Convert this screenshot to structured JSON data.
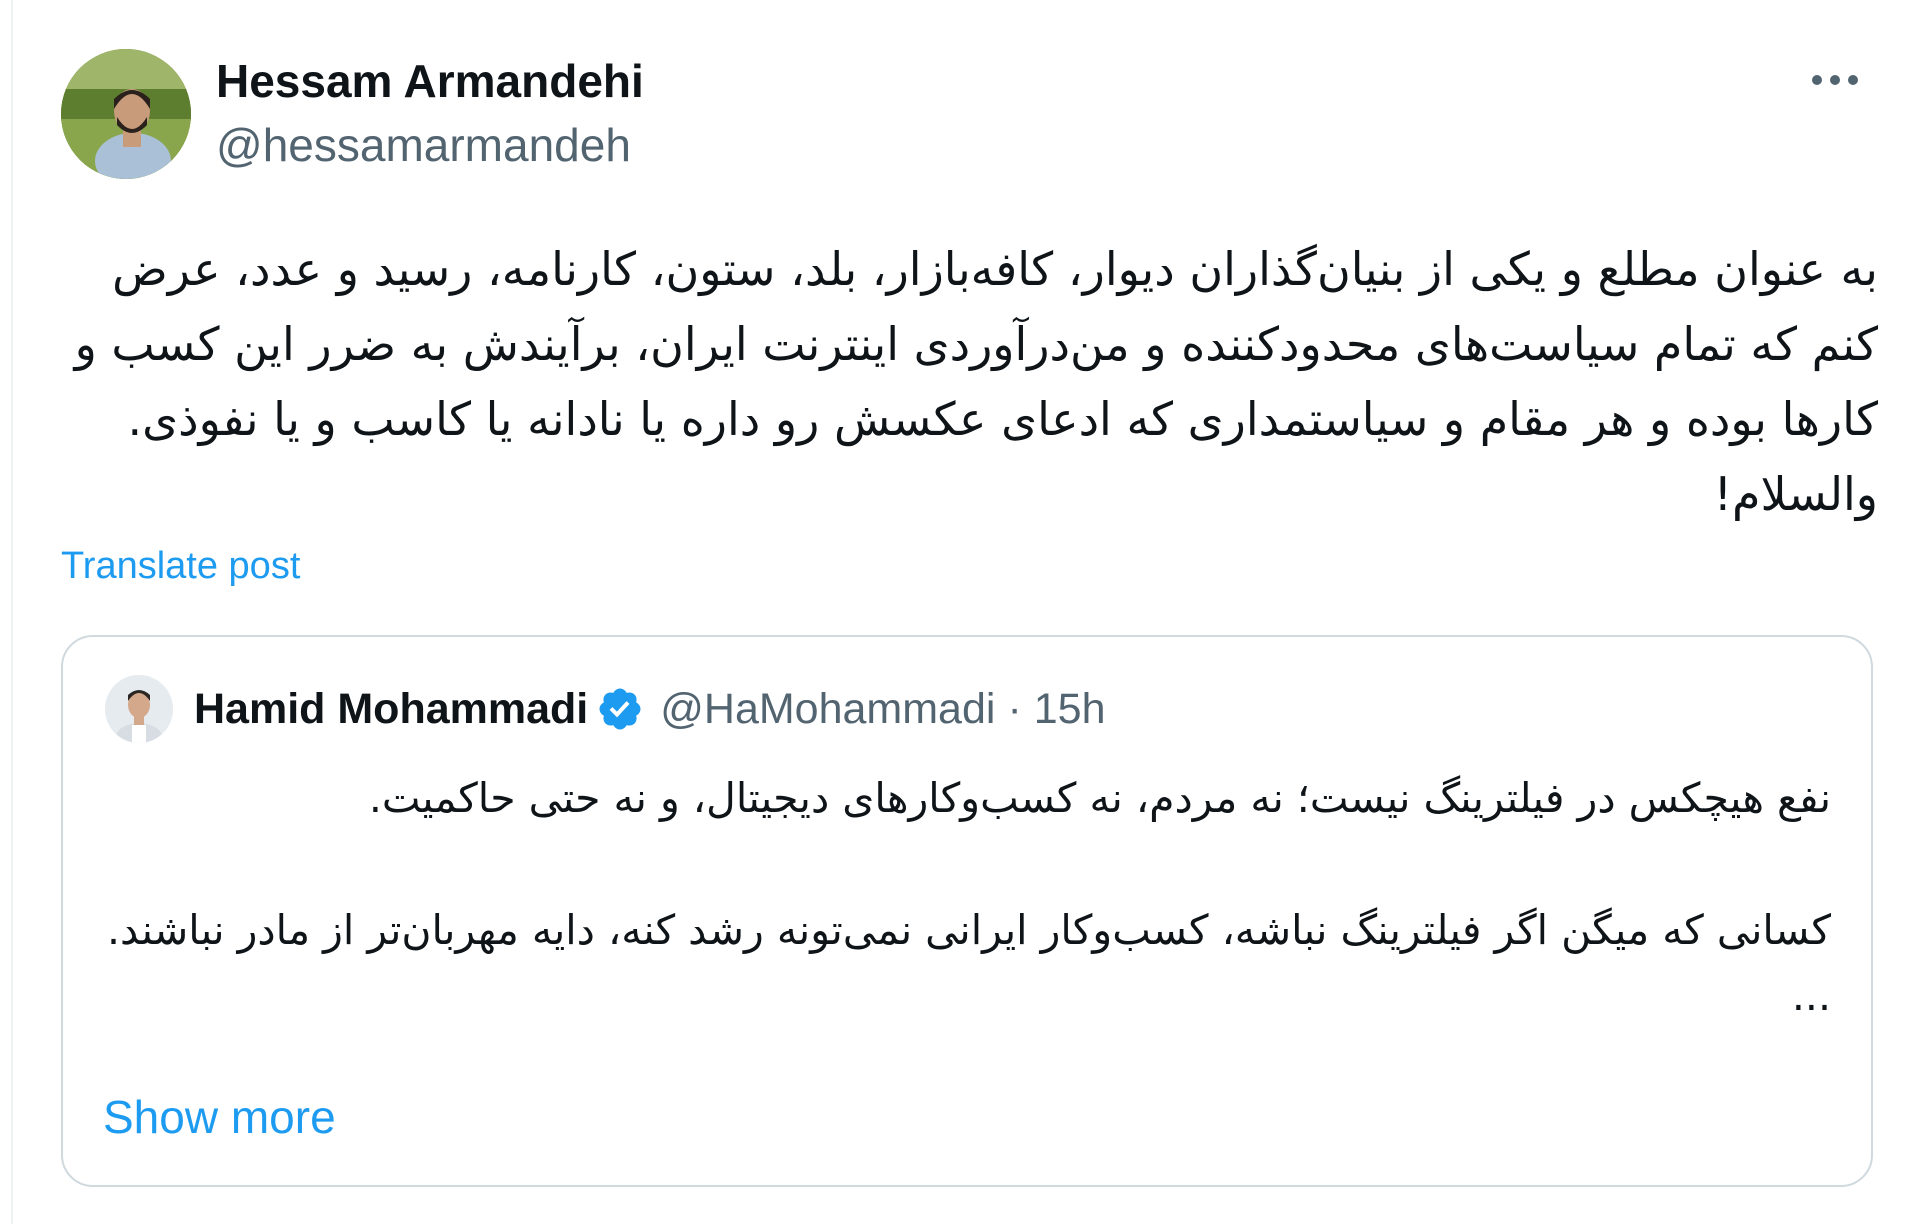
{
  "post": {
    "author": {
      "name": "Hessam Armandehi",
      "handle": "@hessamarmandeh"
    },
    "more_icon": "more-horizontal-icon",
    "text": "به عنوان مطلع و یکی از بنیان‌گذاران دیوار، کافه‌بازار، بلد، ستون، کارنامه، رسید و عدد، عرض کنم که تمام سیاست‌های محدودکننده و من‌درآوردی اینترنت ایران، برآیندش به ضرر این کسب و کارها بوده و هر مقام و سیاستمداری که ادعای عکسش رو داره یا نادانه یا کاسب و یا نفوذی. والسلام!",
    "translate_label": "Translate post"
  },
  "quote": {
    "author": {
      "name": "Hamid Mohammadi",
      "handle": "@HaMohammadi",
      "verified_icon": "verified-badge-icon"
    },
    "separator": "·",
    "time": "15h",
    "text": "نفع هیچکس در فیلترینگ نیست؛ نه مردم، نه کسب‌وکارهای دیجیتال، و نه حتی حاکمیت.\n\nکسانی که میگن اگر فیلترینگ نباشه، کسب‌وکار ایرانی نمی‌تونه رشد کنه، دایه مهربان‌تر از مادر نباشند.\n...",
    "show_more_label": "Show more"
  },
  "colors": {
    "text_primary": "#0f1419",
    "text_secondary": "#536471",
    "link": "#1d9bf0",
    "border": "#cfd9de",
    "verified": "#1d9bf0"
  }
}
